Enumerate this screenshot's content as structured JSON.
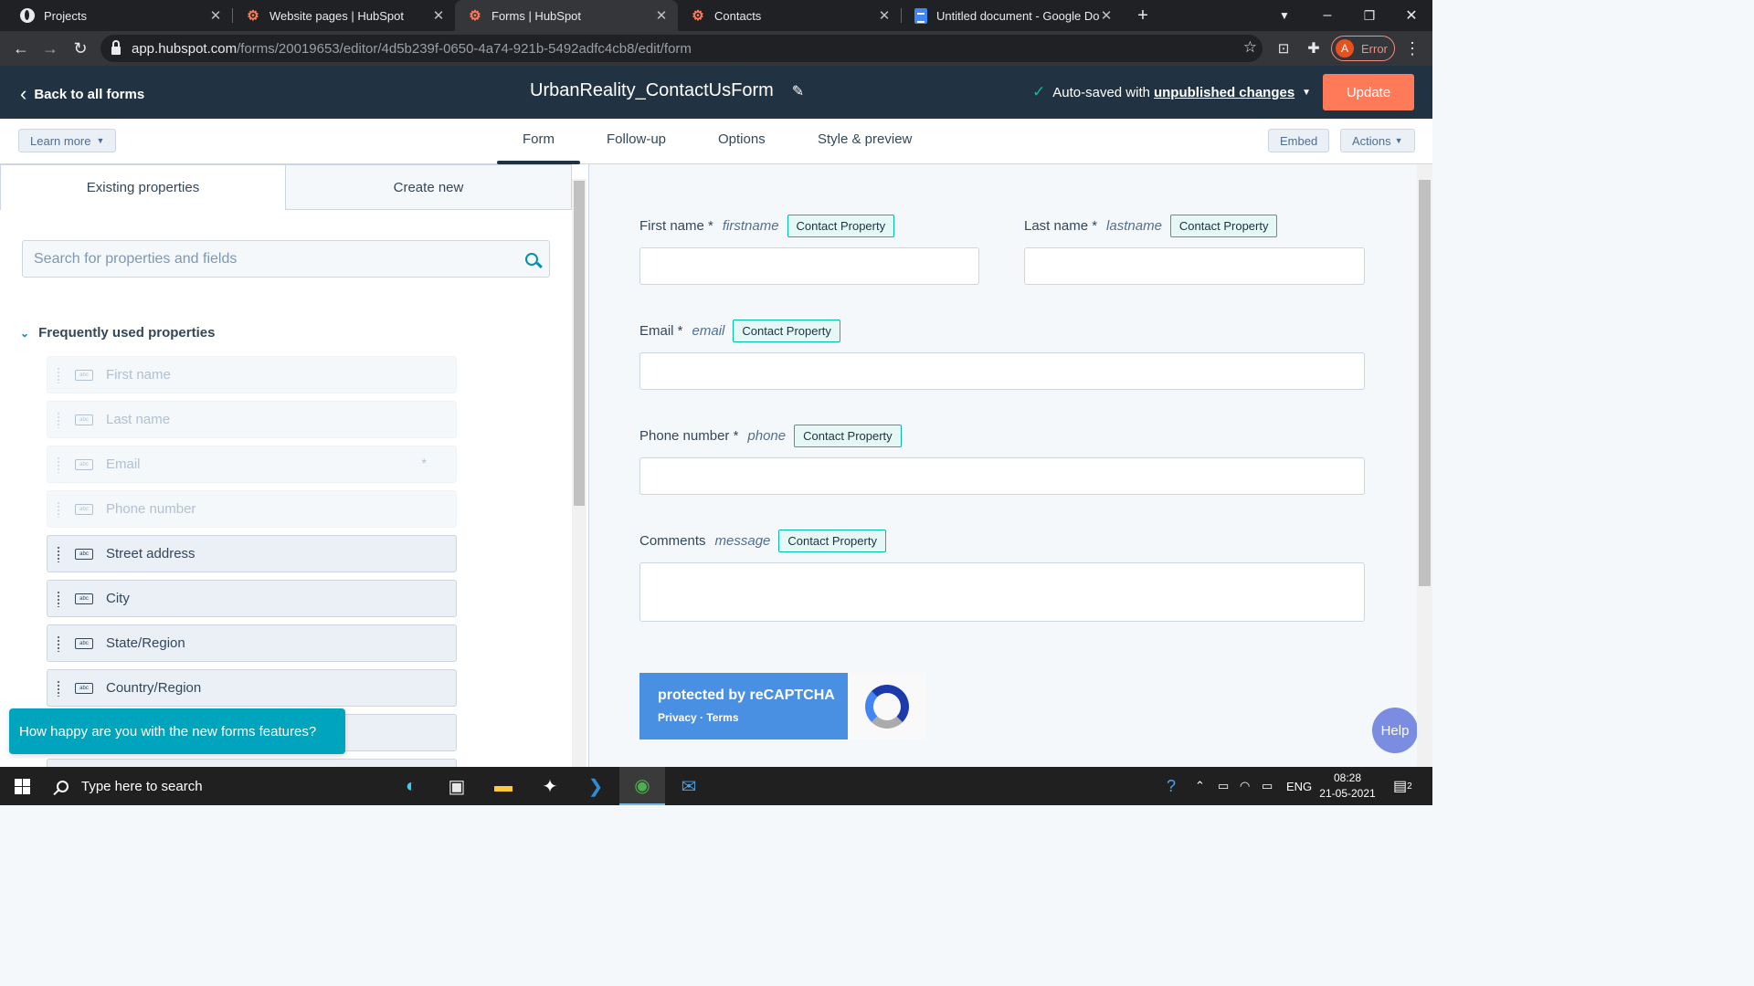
{
  "browser": {
    "tabs": [
      {
        "title": "Projects",
        "icon": "globe-icon"
      },
      {
        "title": "Website pages | HubSpot",
        "icon": "hubspot-icon"
      },
      {
        "title": "Forms | HubSpot",
        "icon": "hubspot-icon",
        "active": true
      },
      {
        "title": "Contacts",
        "icon": "hubspot-icon"
      },
      {
        "title": "Untitled document - Google Doc",
        "icon": "google-docs-icon"
      }
    ],
    "url_host": "app.hubspot.com",
    "url_path": "/forms/20019653/editor/4d5b239f-0650-4a74-921b-5492adfc4cb8/edit/form",
    "profile_initial": "A",
    "profile_status": "Error"
  },
  "header": {
    "back_label": "Back to all forms",
    "form_title": "UrbanReality_ContactUsForm",
    "autosave_prefix": "Auto-saved with",
    "autosave_link": "unpublished changes",
    "update_label": "Update"
  },
  "subnav": {
    "learn_more": "Learn more",
    "tabs": [
      "Form",
      "Follow-up",
      "Options",
      "Style & preview"
    ],
    "embed": "Embed",
    "actions": "Actions"
  },
  "left_panel": {
    "tabs": [
      "Existing properties",
      "Create new"
    ],
    "search_placeholder": "Search for properties and fields",
    "section_title": "Frequently used properties",
    "properties": [
      {
        "label": "First name",
        "state": "disabled"
      },
      {
        "label": "Last name",
        "state": "disabled"
      },
      {
        "label": "Email",
        "state": "disabled",
        "required": "*"
      },
      {
        "label": "Phone number",
        "state": "disabled"
      },
      {
        "label": "Street address",
        "state": "enabled"
      },
      {
        "label": "City",
        "state": "enabled"
      },
      {
        "label": "State/Region",
        "state": "enabled"
      },
      {
        "label": "Country/Region",
        "state": "enabled"
      }
    ],
    "feedback_banner": "How happy are you with the new forms features?"
  },
  "form_preview": {
    "badge_label": "Contact Property",
    "fields": [
      {
        "label": "First name *",
        "internal": "firstname"
      },
      {
        "label": "Last name *",
        "internal": "lastname"
      },
      {
        "label": "Email *",
        "internal": "email"
      },
      {
        "label": "Phone number *",
        "internal": "phone"
      },
      {
        "label": "Comments",
        "internal": "message"
      }
    ],
    "recaptcha_title": "protected by reCAPTCHA",
    "recaptcha_links": "Privacy · Terms",
    "help_label": "Help"
  },
  "taskbar": {
    "search_placeholder": "Type here to search",
    "language": "ENG",
    "time": "08:28",
    "date": "21-05-2021",
    "notification_count": "2"
  }
}
